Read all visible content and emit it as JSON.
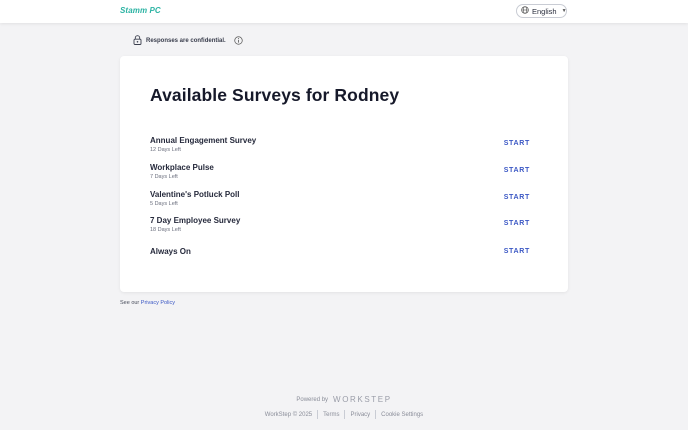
{
  "header": {
    "logo": "Stamm PC",
    "language": "English"
  },
  "notice": {
    "text": "Responses are confidential."
  },
  "main": {
    "title": "Available Surveys for Rodney",
    "surveys": [
      {
        "name": "Annual Engagement Survey",
        "days_left": "12 Days Left",
        "action": "START"
      },
      {
        "name": "Workplace Pulse",
        "days_left": "7 Days Left",
        "action": "START"
      },
      {
        "name": "Valentine's Potluck Poll",
        "days_left": "5 Days Left",
        "action": "START"
      },
      {
        "name": "7 Day Employee Survey",
        "days_left": "18 Days Left",
        "action": "START"
      },
      {
        "name": "Always On",
        "days_left": "",
        "action": "START"
      }
    ]
  },
  "privacy": {
    "prefix": "See our",
    "link": "Privacy Policy"
  },
  "footer": {
    "powered_by": "Powered by",
    "brand": "WORKSTEP",
    "copyright": "WorkStep © 2025",
    "links": [
      "Terms",
      "Privacy",
      "Cookie Settings"
    ]
  },
  "colors": {
    "accent": "#3a57c4",
    "logo": "#2bb3a3",
    "background": "#f3f3f5"
  }
}
